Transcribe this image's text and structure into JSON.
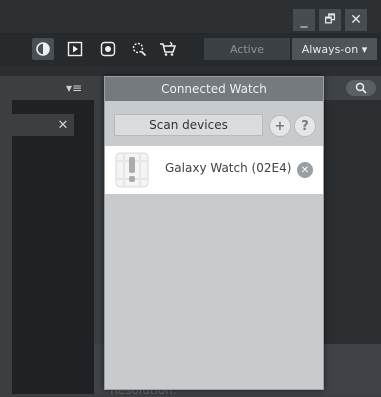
{
  "window": {
    "minimize_glyph": "_",
    "restore_glyph": "🗗",
    "close_glyph": "✕"
  },
  "toolbar": {
    "icons": [
      "display-mode-icon",
      "play-icon",
      "record-icon",
      "zoom-icon",
      "cart-icon"
    ],
    "modes": {
      "active_label": "Active",
      "always_on_label": "Always-on ▾"
    }
  },
  "left_panel": {
    "menu_glyph": "▾≡",
    "clear_glyph": "✕"
  },
  "popup": {
    "title": "Connected Watch",
    "scan_label": "Scan devices",
    "add_glyph": "+",
    "help_glyph": "?",
    "devices": [
      {
        "name": "Galaxy Watch (02E4)"
      }
    ]
  },
  "background": {
    "resolution_label": "Resolution:"
  },
  "colors": {
    "popup_bg": "#c7cbce",
    "popup_title_bg": "#747a7e",
    "device_row_bg": "#ffffff"
  }
}
